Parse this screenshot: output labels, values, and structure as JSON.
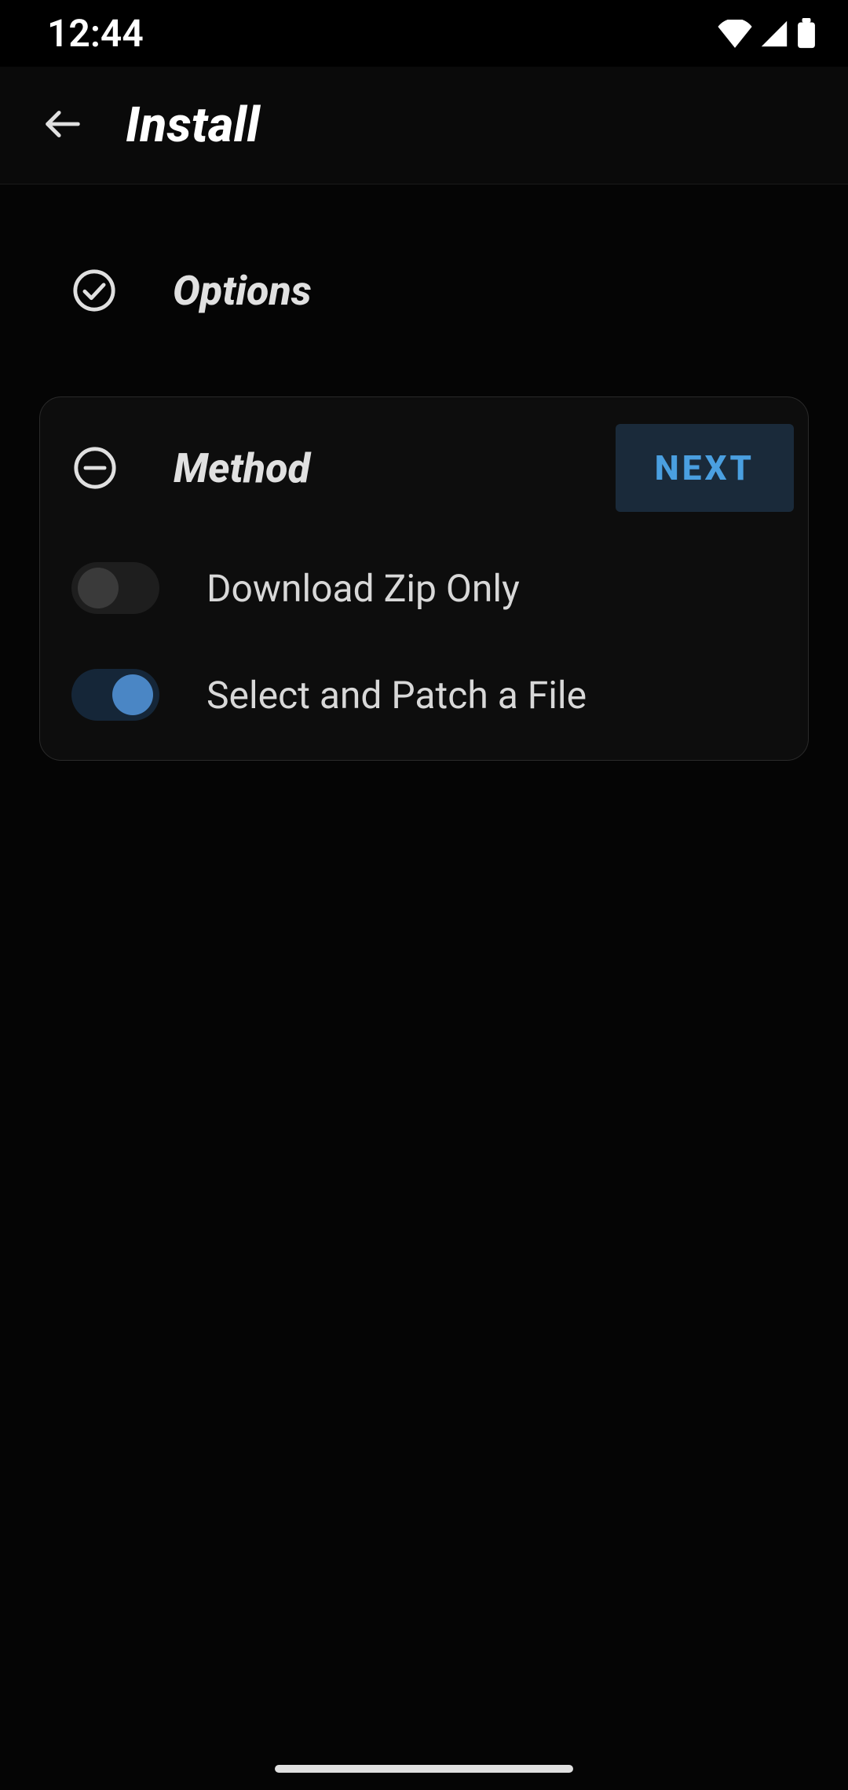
{
  "statusbar": {
    "time": "12:44"
  },
  "appbar": {
    "title": "Install"
  },
  "steps": {
    "options": {
      "label": "Options",
      "completed": true
    },
    "method": {
      "label": "Method",
      "next_label": "NEXT",
      "toggles": [
        {
          "label": "Download Zip Only",
          "on": false
        },
        {
          "label": "Select and Patch a File",
          "on": true
        }
      ]
    }
  },
  "colors": {
    "accent": "#4a9fe0",
    "switch_on_knob": "#4a86c5",
    "card_border": "#2a2a2a"
  }
}
